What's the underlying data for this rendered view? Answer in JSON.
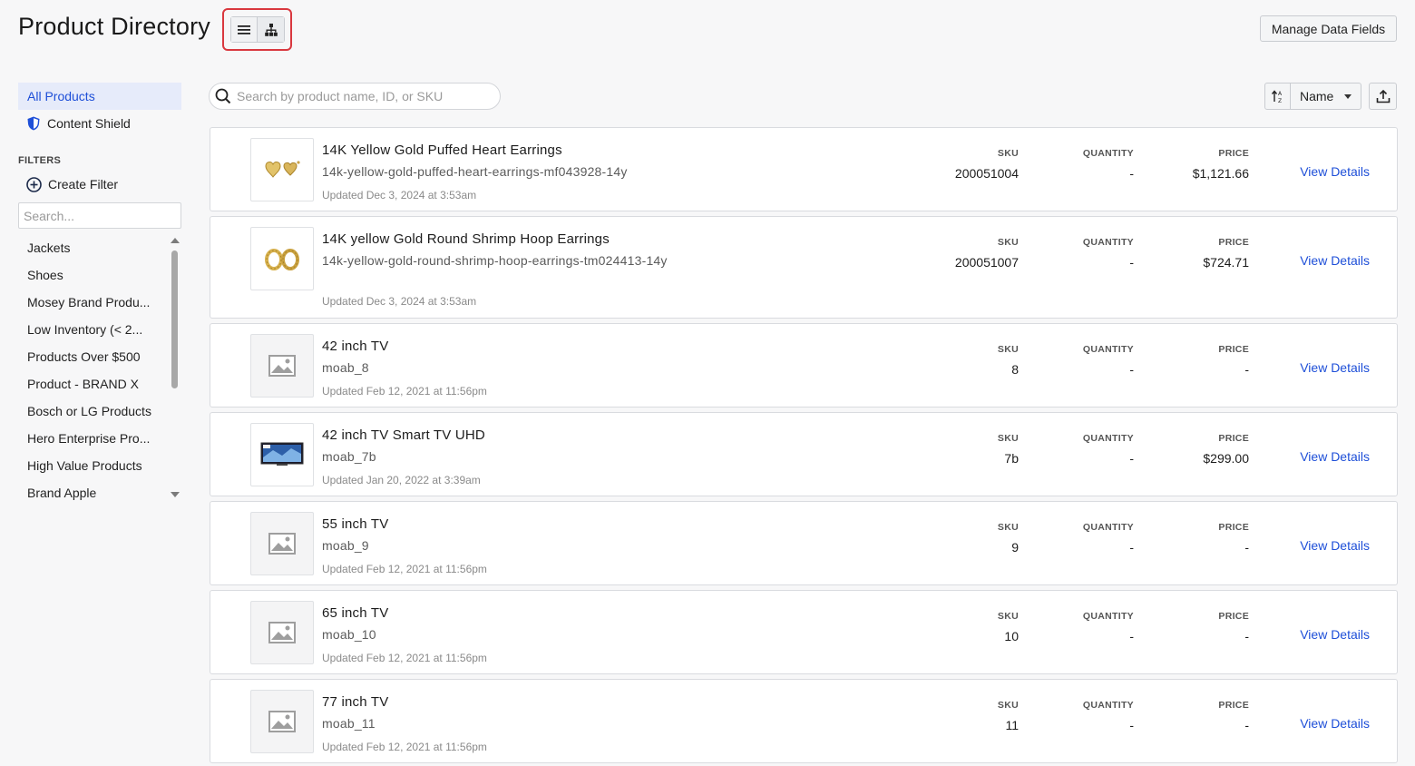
{
  "header": {
    "title": "Product Directory",
    "manage_fields_label": "Manage Data Fields"
  },
  "sidebar": {
    "nav": [
      {
        "label": "All Products",
        "active": true
      },
      {
        "label": "Content Shield",
        "icon": "shield-icon"
      }
    ],
    "filters_heading": "FILTERS",
    "create_filter_label": "Create Filter",
    "filter_search_placeholder": "Search...",
    "filters": [
      "Jackets",
      "Shoes",
      "Mosey Brand Produ...",
      "Low Inventory (< 2...",
      "Products Over $500",
      "Product - BRAND X",
      "Bosch or LG Products",
      "Hero Enterprise Pro...",
      "High Value Products",
      "Brand Apple"
    ]
  },
  "toolbar": {
    "search_placeholder": "Search by product name, ID, or SKU",
    "sort_field": "Name"
  },
  "columns": {
    "sku": "SKU",
    "quantity": "QUANTITY",
    "price": "PRICE"
  },
  "view_details_label": "View Details",
  "products": [
    {
      "name": "14K Yellow Gold Puffed Heart Earrings",
      "slug": "14k-yellow-gold-puffed-heart-earrings-mf043928-14y",
      "updated": "Updated Dec 3, 2024 at 3:53am",
      "sku": "200051004",
      "quantity": "-",
      "price": "$1,121.66",
      "image": "heart-earrings-image"
    },
    {
      "name": "14K yellow Gold Round Shrimp Hoop Earrings",
      "slug": "14k-yellow-gold-round-shrimp-hoop-earrings-tm024413-14y",
      "updated": "Updated Dec 3, 2024 at 3:53am",
      "sku": "200051007",
      "quantity": "-",
      "price": "$724.71",
      "image": "hoop-earrings-image"
    },
    {
      "name": "42 inch TV",
      "slug": "moab_8",
      "updated": "Updated Feb 12, 2021 at 11:56pm",
      "sku": "8",
      "quantity": "-",
      "price": "-",
      "image": "placeholder-image-icon"
    },
    {
      "name": "42 inch TV Smart TV UHD",
      "slug": "moab_7b",
      "updated": "Updated Jan 20, 2022 at 3:39am",
      "sku": "7b",
      "quantity": "-",
      "price": "$299.00",
      "image": "tv-image"
    },
    {
      "name": "55 inch TV",
      "slug": "moab_9",
      "updated": "Updated Feb 12, 2021 at 11:56pm",
      "sku": "9",
      "quantity": "-",
      "price": "-",
      "image": "placeholder-image-icon"
    },
    {
      "name": "65 inch TV",
      "slug": "moab_10",
      "updated": "Updated Feb 12, 2021 at 11:56pm",
      "sku": "10",
      "quantity": "-",
      "price": "-",
      "image": "placeholder-image-icon"
    },
    {
      "name": "77 inch TV",
      "slug": "moab_11",
      "updated": "Updated Feb 12, 2021 at 11:56pm",
      "sku": "11",
      "quantity": "-",
      "price": "-",
      "image": "placeholder-image-icon"
    }
  ],
  "colors": {
    "accent": "#1e4fd8",
    "highlight_border": "#d9383f",
    "active_nav_bg": "#e6ebfa"
  }
}
